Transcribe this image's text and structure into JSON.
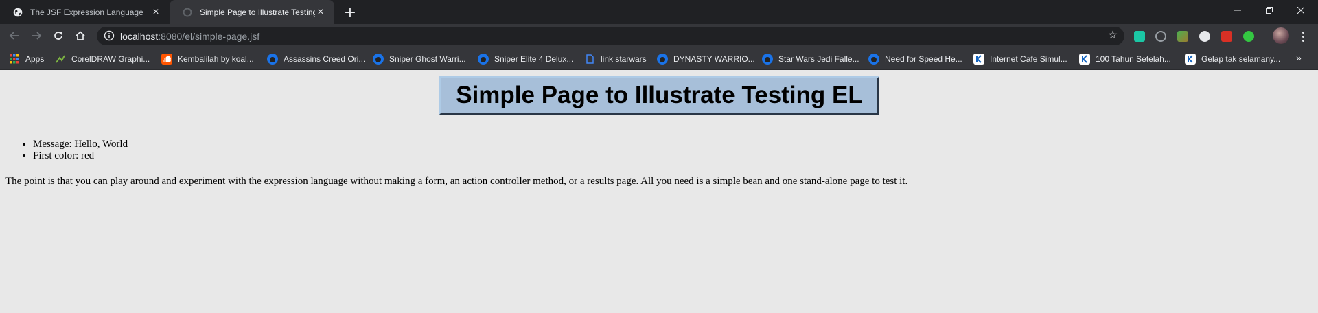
{
  "browser": {
    "tabs": [
      {
        "title": "The JSF Expression Language",
        "active": false,
        "icon": "globe-icon"
      },
      {
        "title": "Simple Page to Illustrate Testing EL",
        "active": true,
        "icon": "loading-icon"
      }
    ],
    "new_tab_label": "+",
    "address": {
      "host": "localhost",
      "rest": ":8080/el/simple-page.jsf"
    },
    "bookmarks": [
      {
        "label": "Apps",
        "icon": "apps-grid-icon"
      },
      {
        "label": "CorelDRAW Graphi...",
        "icon": "corel-icon"
      },
      {
        "label": "Kembalilah by koal...",
        "icon": "soundcloud-icon"
      },
      {
        "label": "Assassins Creed Ori...",
        "icon": "game-site-icon"
      },
      {
        "label": "Sniper Ghost Warri...",
        "icon": "game-site-icon"
      },
      {
        "label": "Sniper Elite 4 Delux...",
        "icon": "game-site-icon"
      },
      {
        "label": "link starwars",
        "icon": "document-link-icon"
      },
      {
        "label": "DYNASTY WARRIO...",
        "icon": "game-site-icon"
      },
      {
        "label": "Star Wars Jedi Falle...",
        "icon": "game-site-icon"
      },
      {
        "label": "Need for Speed He...",
        "icon": "game-site-icon"
      },
      {
        "label": "Internet Cafe Simul...",
        "icon": "k-site-icon"
      },
      {
        "label": "100 Tahun Setelah...",
        "icon": "k-site-icon"
      },
      {
        "label": "Gelap tak selamany...",
        "icon": "k-site-icon"
      }
    ],
    "bookmarks_more": "»"
  },
  "page": {
    "heading": "Simple Page to Illustrate Testing EL",
    "items": [
      "Message: Hello, World",
      "First color: red"
    ],
    "paragraph": "The point is that you can play around and experiment with the expression language without making a form, an action controller method, or a results page. All you need is a simple bean and one stand-alone page to test it."
  },
  "colors": {
    "tabstrip_bg": "#202124",
    "toolbar_bg": "#35363a",
    "page_bg": "#e8e8e8",
    "heading_box_bg": "#a7bfd9"
  }
}
